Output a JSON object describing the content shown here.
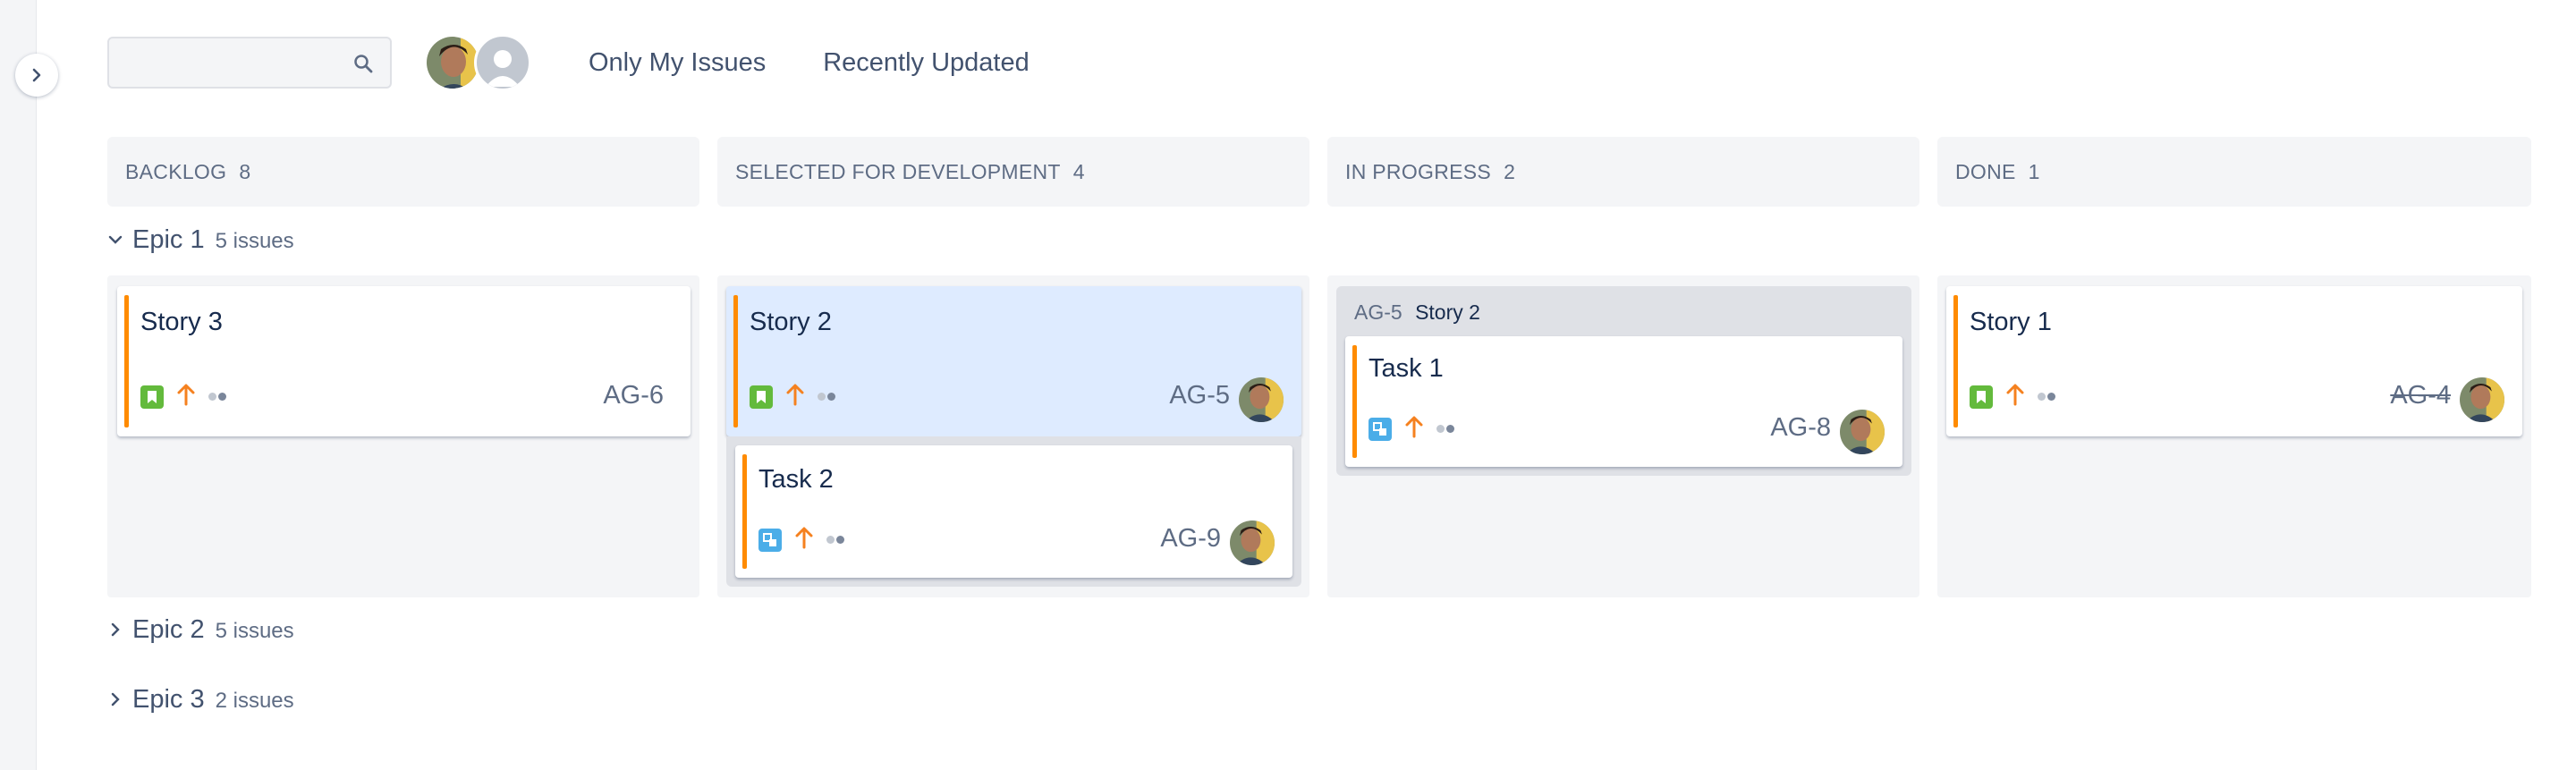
{
  "search": {
    "placeholder": "",
    "icon": "search-icon"
  },
  "filters": {
    "only_mine": "Only My Issues",
    "recent": "Recently Updated"
  },
  "columns": [
    {
      "name": "BACKLOG",
      "count": "8"
    },
    {
      "name": "SELECTED FOR DEVELOPMENT",
      "count": "4"
    },
    {
      "name": "IN PROGRESS",
      "count": "2"
    },
    {
      "name": "DONE",
      "count": "1"
    }
  ],
  "swimlanes": [
    {
      "name": "Epic 1",
      "count": "5 issues",
      "expanded": true
    },
    {
      "name": "Epic 2",
      "count": "5 issues",
      "expanded": false
    },
    {
      "name": "Epic 3",
      "count": "2 issues",
      "expanded": false
    }
  ],
  "cards": {
    "story3": {
      "title": "Story 3",
      "key": "AG-6",
      "type": "story",
      "priority": "high"
    },
    "story2": {
      "title": "Story 2",
      "key": "AG-5",
      "type": "story",
      "priority": "high"
    },
    "task2": {
      "title": "Task 2",
      "key": "AG-9",
      "type": "subtask",
      "priority": "high"
    },
    "task1": {
      "title": "Task 1",
      "key": "AG-8",
      "type": "subtask",
      "priority": "high"
    },
    "story1": {
      "title": "Story 1",
      "key": "AG-4",
      "type": "story",
      "priority": "high",
      "done": true
    }
  },
  "parent_group": {
    "key": "AG-5",
    "name": "Story 2"
  },
  "colors": {
    "accent": "#ff8b00",
    "story": "#63ba3c",
    "subtask": "#4bade8",
    "selected": "#deebff"
  }
}
